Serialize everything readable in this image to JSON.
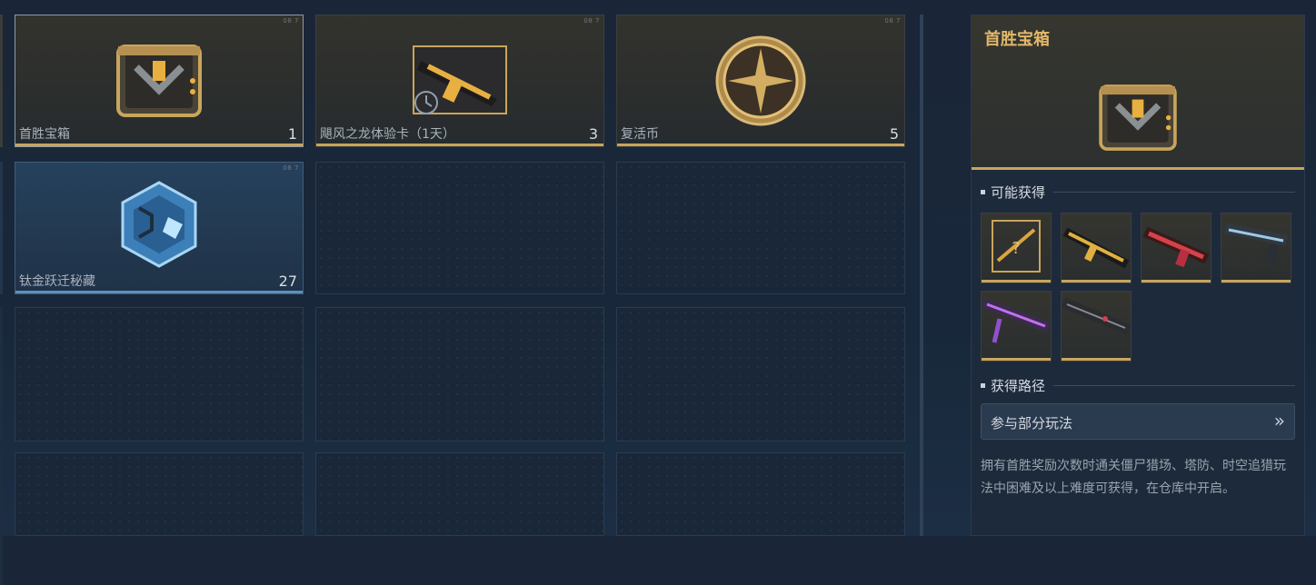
{
  "inventory": {
    "slots": [
      {
        "name": "首胜宝箱",
        "count": "1",
        "corner": "08 7"
      },
      {
        "name": "飓风之龙体验卡（1天）",
        "count": "3",
        "corner": "08 7"
      },
      {
        "name": "复活币",
        "count": "5",
        "corner": "08 7"
      },
      {
        "name": "钛金跃迁秘藏",
        "count": "27",
        "corner": "08 7"
      }
    ]
  },
  "detail": {
    "title": "首胜宝箱",
    "possible_title": "可能获得",
    "route_title": "获得路径",
    "route_button": "参与部分玩法",
    "route_chevron": "»",
    "description": "拥有首胜奖励次数时通关僵尸猎场、塔防、时空追猎玩法中困难及以上难度可获得，在仓库中开启。"
  },
  "colors": {
    "gold": "#c9a55c",
    "blue": "#5c8fbd",
    "title": "#e2b76a"
  }
}
